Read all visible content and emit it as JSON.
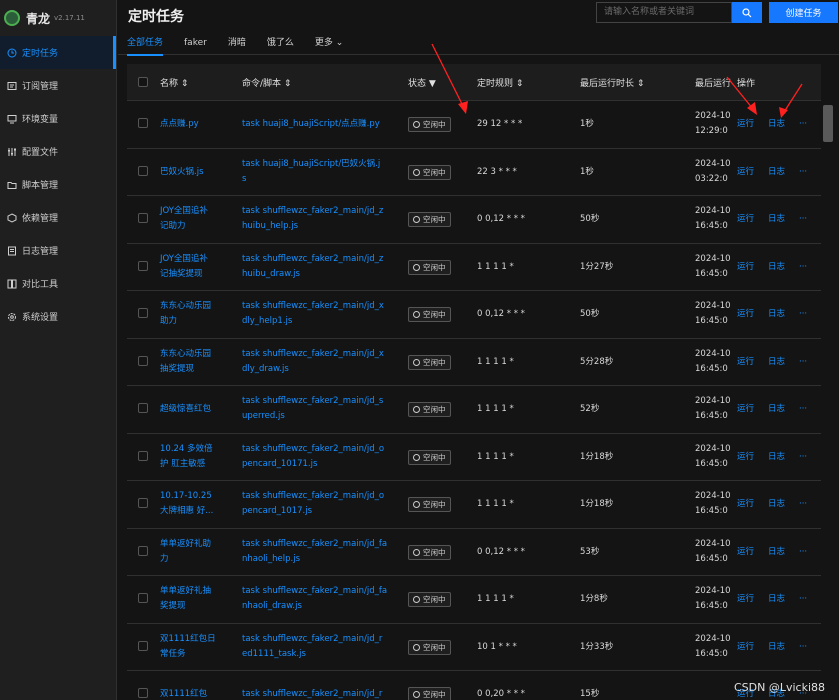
{
  "app": {
    "name": "青龙",
    "version": "v2.17.11"
  },
  "sidebar": {
    "items": [
      {
        "label": "定时任务",
        "icon": "clock-icon"
      },
      {
        "label": "订阅管理",
        "icon": "subscribe-icon"
      },
      {
        "label": "环境变量",
        "icon": "monitor-icon"
      },
      {
        "label": "配置文件",
        "icon": "settings-sliders-icon"
      },
      {
        "label": "脚本管理",
        "icon": "folder-icon"
      },
      {
        "label": "依赖管理",
        "icon": "box-icon"
      },
      {
        "label": "日志管理",
        "icon": "log-icon"
      },
      {
        "label": "对比工具",
        "icon": "diff-icon"
      },
      {
        "label": "系统设置",
        "icon": "gear-icon"
      }
    ]
  },
  "header": {
    "title": "定时任务",
    "search_placeholder": "请输入名称或者关键词",
    "create_label": "创建任务"
  },
  "tabs": [
    "全部任务",
    "faker",
    "消暗",
    "饿了么",
    "更多"
  ],
  "table": {
    "columns": {
      "name": "名称",
      "command": "命令/脚本",
      "status": "状态",
      "schedule": "定时规则",
      "last_duration": "最后运行时长",
      "last_run": "最后运行",
      "actions": "操作"
    },
    "run_label": "运行",
    "log_label": "日志",
    "more_label": "···",
    "status_idle": "空闲中",
    "rows": [
      {
        "name1": "点点赚.py",
        "name2": "",
        "cmd1": "task huaji8_huajiScript/点点赚.py",
        "cmd2": "",
        "schedule": "29 12 * * *",
        "duration": "1秒",
        "run1": "2024-10",
        "run2": "12:29:0"
      },
      {
        "name1": "巴奴火锅.js",
        "name2": "",
        "cmd1": "task huaji8_huajiScript/巴奴火锅.j",
        "cmd2": "s",
        "schedule": "22 3 * * *",
        "duration": "1秒",
        "run1": "2024-10",
        "run2": "03:22:0"
      },
      {
        "name1": "JOY全国追补",
        "name2": "记助力",
        "cmd1": "task shufflewzc_faker2_main/jd_z",
        "cmd2": "huibu_help.js",
        "schedule": "0 0,12 * * *",
        "duration": "50秒",
        "run1": "2024-10",
        "run2": "16:45:0"
      },
      {
        "name1": "JOY全国追补",
        "name2": "记抽奖提现",
        "cmd1": "task shufflewzc_faker2_main/jd_z",
        "cmd2": "huibu_draw.js",
        "schedule": "1 1 1 1 *",
        "duration": "1分27秒",
        "run1": "2024-10",
        "run2": "16:45:0"
      },
      {
        "name1": "东东心动乐园",
        "name2": "助力",
        "cmd1": "task shufflewzc_faker2_main/jd_x",
        "cmd2": "dly_help1.js",
        "schedule": "0 0,12 * * *",
        "duration": "50秒",
        "run1": "2024-10",
        "run2": "16:45:0"
      },
      {
        "name1": "东东心动乐园",
        "name2": "抽奖提现",
        "cmd1": "task shufflewzc_faker2_main/jd_x",
        "cmd2": "dly_draw.js",
        "schedule": "1 1 1 1 *",
        "duration": "5分28秒",
        "run1": "2024-10",
        "run2": "16:45:0"
      },
      {
        "name1": "超级惊喜红包",
        "name2": "",
        "cmd1": "task shufflewzc_faker2_main/jd_s",
        "cmd2": "uperred.js",
        "schedule": "1 1 1 1 *",
        "duration": "52秒",
        "run1": "2024-10",
        "run2": "16:45:0"
      },
      {
        "name1": "10.24 多效倍",
        "name2": "护 肛主敏感",
        "cmd1": "task shufflewzc_faker2_main/jd_o",
        "cmd2": "pencard_10171.js",
        "schedule": "1 1 1 1 *",
        "duration": "1分18秒",
        "run1": "2024-10",
        "run2": "16:45:0"
      },
      {
        "name1": "10.17-10.25",
        "name2": "大牌相惠 好...",
        "cmd1": "task shufflewzc_faker2_main/jd_o",
        "cmd2": "pencard_1017.js",
        "schedule": "1 1 1 1 *",
        "duration": "1分18秒",
        "run1": "2024-10",
        "run2": "16:45:0"
      },
      {
        "name1": "单单返好礼助",
        "name2": "力",
        "cmd1": "task shufflewzc_faker2_main/jd_fa",
        "cmd2": "nhaoli_help.js",
        "schedule": "0 0,12 * * *",
        "duration": "53秒",
        "run1": "2024-10",
        "run2": "16:45:0"
      },
      {
        "name1": "单单返好礼抽",
        "name2": "奖提现",
        "cmd1": "task shufflewzc_faker2_main/jd_fa",
        "cmd2": "nhaoli_draw.js",
        "schedule": "1 1 1 1 *",
        "duration": "1分8秒",
        "run1": "2024-10",
        "run2": "16:45:0"
      },
      {
        "name1": "双1111红包日",
        "name2": "常任务",
        "cmd1": "task shufflewzc_faker2_main/jd_r",
        "cmd2": "ed1111_task.js",
        "schedule": "10 1 * * *",
        "duration": "1分33秒",
        "run1": "2024-10",
        "run2": "16:45:0"
      },
      {
        "name1": "双1111红包",
        "name2": "",
        "cmd1": "task shufflewzc_faker2_main/jd_r",
        "cmd2": "",
        "schedule": "0 0,20 * * *",
        "duration": "15秒",
        "run1": "",
        "run2": ""
      }
    ]
  },
  "watermark": "CSDN @Lvicki88",
  "colors": {
    "accent": "#1890ff",
    "annotation": "#ff2020"
  }
}
